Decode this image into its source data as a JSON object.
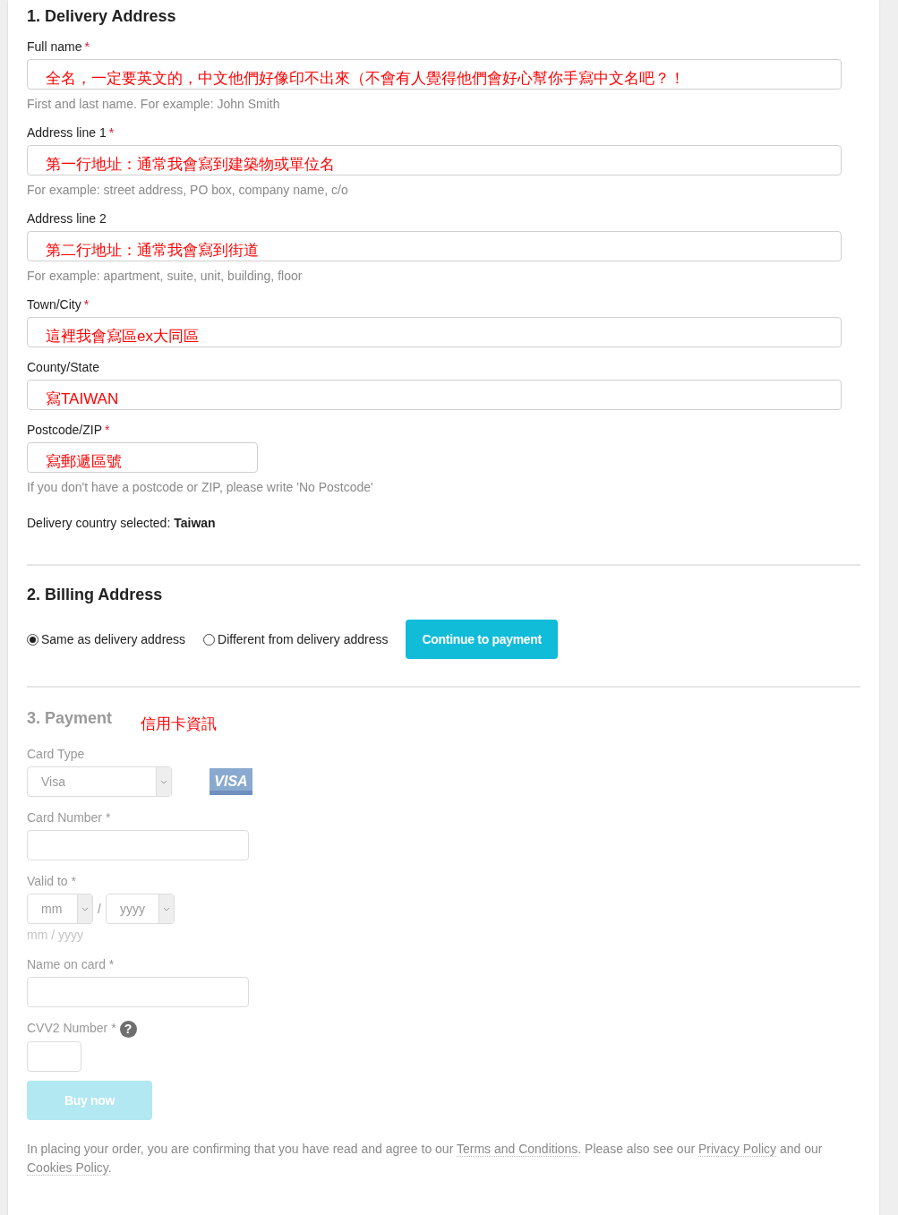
{
  "delivery": {
    "title": "1. Delivery Address",
    "fields": [
      {
        "label": "Full name",
        "mark": "*",
        "value": "全名，一定要英文的，中文他們好像印不出來（不會有人覺得他們會好心幫你手寫中文名吧？！",
        "hint": "First and last name. For example: John Smith",
        "kind": "text"
      },
      {
        "label": "Address line 1",
        "mark": "*",
        "value": "第一行地址：通常我會寫到建築物或單位名",
        "hint": "For example: street address, PO box, company name, c/o",
        "kind": "text"
      },
      {
        "label": "Address line 2",
        "value": "第二行地址：通常我會寫到街道",
        "hint": "For example: apartment, suite, unit, building, floor",
        "kind": "text"
      },
      {
        "label": "Town/City",
        "mark": "*",
        "value": "這裡我會寫區ex大同區",
        "kind": "text"
      },
      {
        "label": "County/State",
        "value": "寫TAIWAN",
        "kind": "text"
      },
      {
        "label": "Postcode/ZIP",
        "mark": "*",
        "value": "寫郵遞區號",
        "hint": "If you don't have a postcode or ZIP, please write 'No Postcode'",
        "kind": "short_text"
      }
    ],
    "country_note": "Delivery country selected: **Taiwan**"
  },
  "billing": {
    "title": "2. Billing Address",
    "options": [
      {
        "label": "Same as delivery address",
        "selected": true
      },
      {
        "label": "Different from delivery address",
        "selected": false
      }
    ],
    "button": "Continue to payment"
  },
  "payment": {
    "title": "3. Payment",
    "annotation": "信用卡資訊",
    "disabled": true,
    "fields": [
      {
        "kind": "select",
        "label": "Card Type",
        "value": "Visa",
        "logo": "VISA"
      },
      {
        "kind": "text",
        "label": "Card Number *"
      },
      {
        "kind": "expiry",
        "label": "Valid to *",
        "month": "mm",
        "separator": "/",
        "year": "yyyy",
        "hint": "mm / yyyy"
      },
      {
        "kind": "text",
        "label": "Name on card *"
      },
      {
        "kind": "short_text",
        "label": "CVV2 Number *",
        "help": "?"
      }
    ],
    "button": {
      "label": "Buy now",
      "disabled": true
    }
  },
  "legal": [
    {
      "kind": "text",
      "text": "In placing your order, you are confirming that you have read and agree to our "
    },
    {
      "kind": "link",
      "text": "Terms and Conditions"
    },
    {
      "kind": "text",
      "text": ". Please also see our "
    },
    {
      "kind": "link",
      "text": "Privacy Policy"
    },
    {
      "kind": "text",
      "text": " and our "
    },
    {
      "kind": "link",
      "text": "Cookies Policy"
    },
    {
      "kind": "text",
      "text": "."
    }
  ]
}
